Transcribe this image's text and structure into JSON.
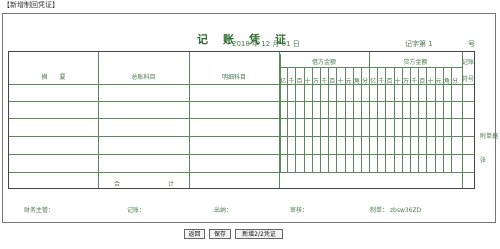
{
  "window": {
    "title": "【新增制回凭证】"
  },
  "voucher": {
    "title": "记账凭证",
    "date": "2018 年 12 月 01 日",
    "number_label": "记字第 1",
    "hao": "号"
  },
  "table": {
    "headers": {
      "summary": "摘　　要",
      "account": "总账科目",
      "detail": "明细科目",
      "debit": "借方金额",
      "credit": "贷方金额",
      "posted": "记账",
      "symbol": "符号"
    },
    "digits": [
      "亿",
      "千",
      "百",
      "十",
      "万",
      "千",
      "百",
      "十",
      "元",
      "角",
      "分"
    ],
    "total_label": "合　　　　　　　　计"
  },
  "side_note": {
    "attach": "附单据",
    "zhang": "张"
  },
  "footer": {
    "supervisor": "财务主管：",
    "bookkeeper": "记账：",
    "cashier": "出纳：",
    "reviewer": "审核：",
    "maker": "制单： zbsw36ZD"
  },
  "buttons": {
    "back": "返回",
    "save": "保存",
    "add_new": "新增2/2凭证"
  },
  "colors": {
    "primary": "#2e6b2e",
    "line": "#5a8a5a"
  }
}
